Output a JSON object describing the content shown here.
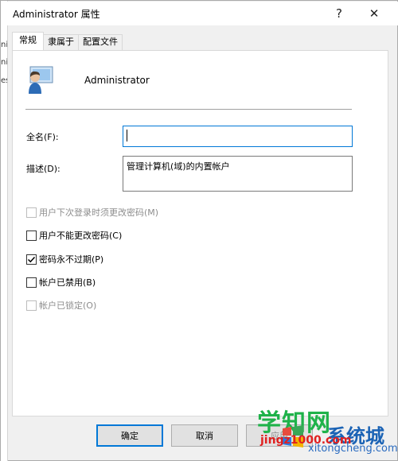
{
  "window": {
    "title": "Administrator 属性",
    "help_glyph": "?",
    "close_glyph": "✕"
  },
  "backdrop": {
    "fragments": [
      "ni",
      "ni",
      "es"
    ]
  },
  "tabs": [
    {
      "label": "常规",
      "active": true
    },
    {
      "label": "隶属于",
      "active": false
    },
    {
      "label": "配置文件",
      "active": false
    }
  ],
  "user": {
    "name": "Administrator",
    "icon": "user-avatar-icon"
  },
  "fields": {
    "fullname_label": "全名(F):",
    "fullname_value": "",
    "description_label": "描述(D):",
    "description_value": "管理计算机(域)的内置帐户"
  },
  "checkboxes": [
    {
      "label": "用户下次登录时须更改密码(M)",
      "checked": false,
      "disabled": true
    },
    {
      "label": "用户不能更改密码(C)",
      "checked": false,
      "disabled": false
    },
    {
      "label": "密码永不过期(P)",
      "checked": true,
      "disabled": false
    },
    {
      "label": "帐户已禁用(B)",
      "checked": false,
      "disabled": false
    },
    {
      "label": "帐户已锁定(O)",
      "checked": false,
      "disabled": true
    }
  ],
  "buttons": {
    "ok": "确定",
    "cancel": "取消",
    "apply": "应用"
  },
  "watermark": {
    "big": "学知网",
    "sys": "系统城",
    "mid": "jingz1000.com",
    "url": "xitongcheng.com"
  },
  "colors": {
    "accent": "#0078d7",
    "watermark_green": "#1fb24a",
    "watermark_blue": "#1b63b5"
  }
}
